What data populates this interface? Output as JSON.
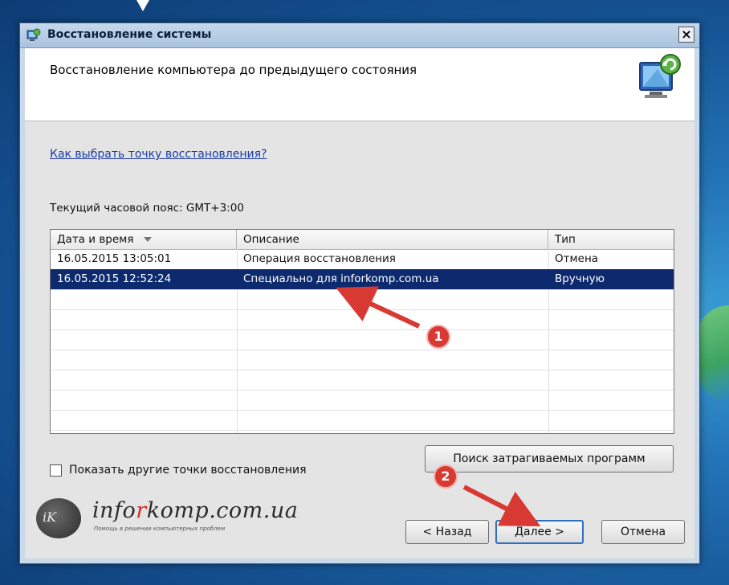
{
  "window": {
    "title": "Восстановление системы",
    "close_label": "×"
  },
  "header": {
    "title": "Восстановление компьютера до предыдущего состояния"
  },
  "content": {
    "help_link": "Как выбрать точку восстановления?",
    "timezone": "Текущий часовой пояс: GMT+3:00"
  },
  "table": {
    "columns": [
      "Дата и время",
      "Описание",
      "Тип"
    ],
    "rows": [
      {
        "date": "16.05.2015 13:05:01",
        "description": "Операция восстановления",
        "type": "Отмена"
      },
      {
        "date": "16.05.2015 12:52:24",
        "description": "Специально для inforkomp.com.ua",
        "type": "Вручную"
      }
    ],
    "selected_row": 1
  },
  "controls": {
    "show_more_label": "Показать другие точки восстановления",
    "affected_programs_button": "Поиск затрагиваемых программ",
    "back_button": "< Назад",
    "next_button": "Далее >",
    "cancel_button": "Отмена"
  },
  "annotations": {
    "badge_1": "1",
    "badge_2": "2"
  },
  "watermark": {
    "logo_text": "iK",
    "text_prefix": "info",
    "text_accent": "r",
    "text_suffix": "komp.com.ua",
    "subtitle": "Помощь в решении компьютерных проблем"
  },
  "colors": {
    "selection": "#0d2a6e",
    "link": "#1a3aa8",
    "annotation_red": "#d83a33"
  }
}
